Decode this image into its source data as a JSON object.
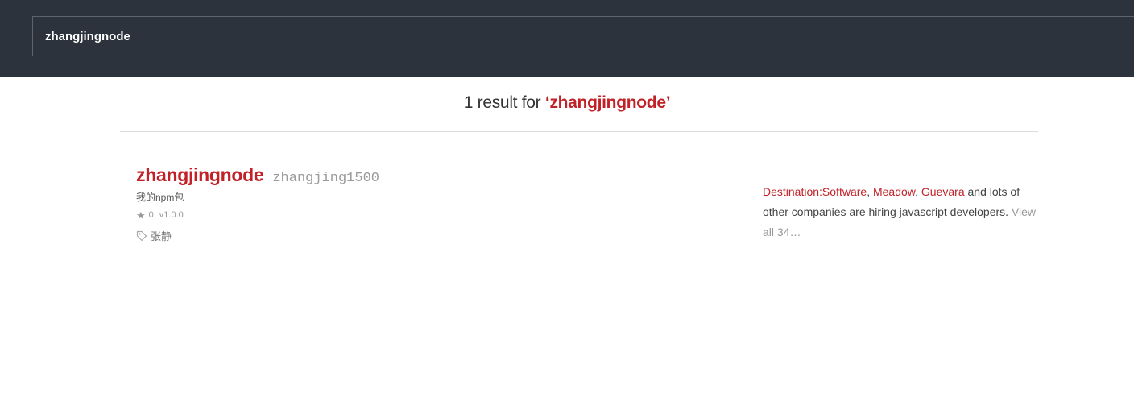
{
  "search": {
    "value": "zhangjingnode",
    "placeholder": ""
  },
  "results": {
    "count_text": "1 result for ",
    "open_quote": "‘",
    "query": "zhangjingnode",
    "close_quote": "’"
  },
  "packages": [
    {
      "name": "zhangjingnode",
      "author": "zhangjing1500",
      "description": "我的npm包",
      "stars": "0",
      "version": "v1.0.0",
      "keywords": [
        "张静"
      ]
    }
  ],
  "jobs": {
    "companies": [
      "Destination:Software",
      "Meadow",
      "Guevara"
    ],
    "separator": ", ",
    "tail_text": " and lots of other companies are hiring javascript developers. ",
    "view_all_label": "View all 34…"
  },
  "colors": {
    "accent": "#c12127",
    "topbar": "#2c333d"
  },
  "icons": {
    "star": "star-icon",
    "tag": "tag-icon"
  }
}
